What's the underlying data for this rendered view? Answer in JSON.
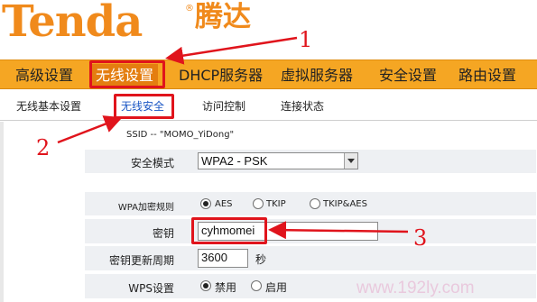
{
  "logo": {
    "latin": "Tenda",
    "registered": "®",
    "chinese": "腾达"
  },
  "main_menu": [
    {
      "label": "高级设置"
    },
    {
      "label": "无线设置"
    },
    {
      "label": "DHCP服务器"
    },
    {
      "label": "虚拟服务器"
    },
    {
      "label": "安全设置"
    },
    {
      "label": "路由设置"
    }
  ],
  "sub_menu": [
    {
      "label": "无线基本设置"
    },
    {
      "label": "无线安全"
    },
    {
      "label": "访问控制"
    },
    {
      "label": "连接状态"
    }
  ],
  "ssid": {
    "text": "SSID -- \"MOMO_YiDong\""
  },
  "security_mode": {
    "label": "安全模式",
    "value": "WPA2 - PSK"
  },
  "wpa_rule": {
    "label": "WPA加密规则",
    "options": [
      "AES",
      "TKIP",
      "TKIP&AES"
    ],
    "selected": "AES"
  },
  "key": {
    "label": "密钥",
    "value": "cyhmomei"
  },
  "key_renewal": {
    "label": "密钥更新周期",
    "value": "3600",
    "unit": "秒"
  },
  "wps": {
    "label": "WPS设置",
    "options": [
      "禁用",
      "启用"
    ],
    "selected": "禁用"
  },
  "annotations": {
    "n1": "1",
    "n2": "2",
    "n3": "3",
    "color": "#e0141c"
  },
  "watermark": "www.192ly.com",
  "colors": {
    "brand_orange": "#f08a1c",
    "menu_bar": "#f5a623",
    "menu_active": "#e47e10",
    "sub_active": "#1a56c4",
    "row_bg": "#eef0f3"
  }
}
